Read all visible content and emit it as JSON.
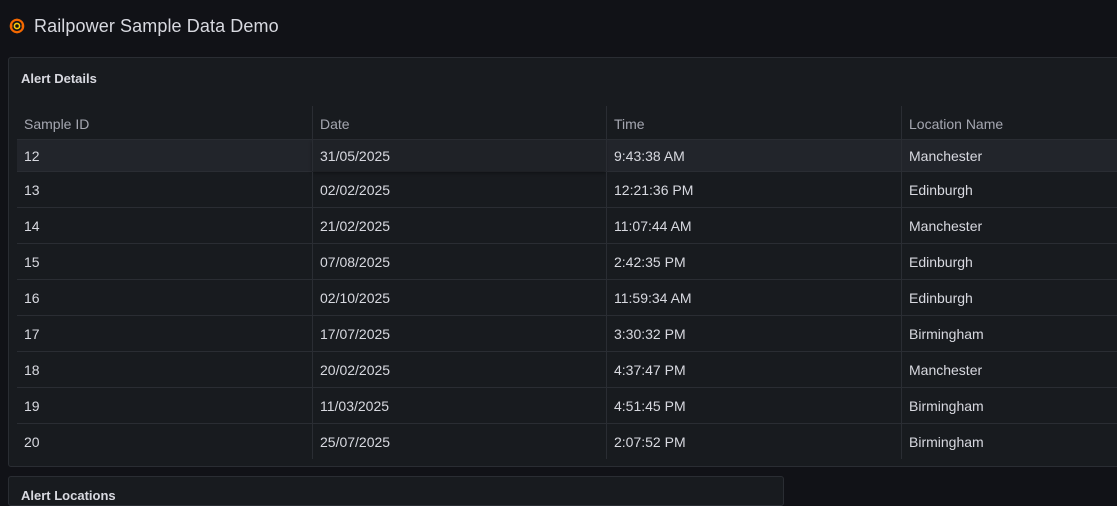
{
  "header": {
    "title": "Railpower Sample Data Demo",
    "logo_icon": "grafana-logo-icon",
    "accent": "#f46800"
  },
  "alert_details": {
    "title": "Alert Details",
    "columns": [
      "Sample ID",
      "Date",
      "Time",
      "Location Name"
    ],
    "rows": [
      [
        "12",
        "31/05/2025",
        "9:43:38 AM",
        "Manchester"
      ],
      [
        "13",
        "02/02/2025",
        "12:21:36 PM",
        "Edinburgh"
      ],
      [
        "14",
        "21/02/2025",
        "11:07:44 AM",
        "Manchester"
      ],
      [
        "15",
        "07/08/2025",
        "2:42:35 PM",
        "Edinburgh"
      ],
      [
        "16",
        "02/10/2025",
        "11:59:34 AM",
        "Edinburgh"
      ],
      [
        "17",
        "17/07/2025",
        "3:30:32 PM",
        "Birmingham"
      ],
      [
        "18",
        "20/02/2025",
        "4:37:47 PM",
        "Manchester"
      ],
      [
        "19",
        "11/03/2025",
        "4:51:45 PM",
        "Birmingham"
      ],
      [
        "20",
        "25/07/2025",
        "2:07:52 PM",
        "Birmingham"
      ]
    ]
  },
  "alert_locations": {
    "title": "Alert Locations"
  }
}
